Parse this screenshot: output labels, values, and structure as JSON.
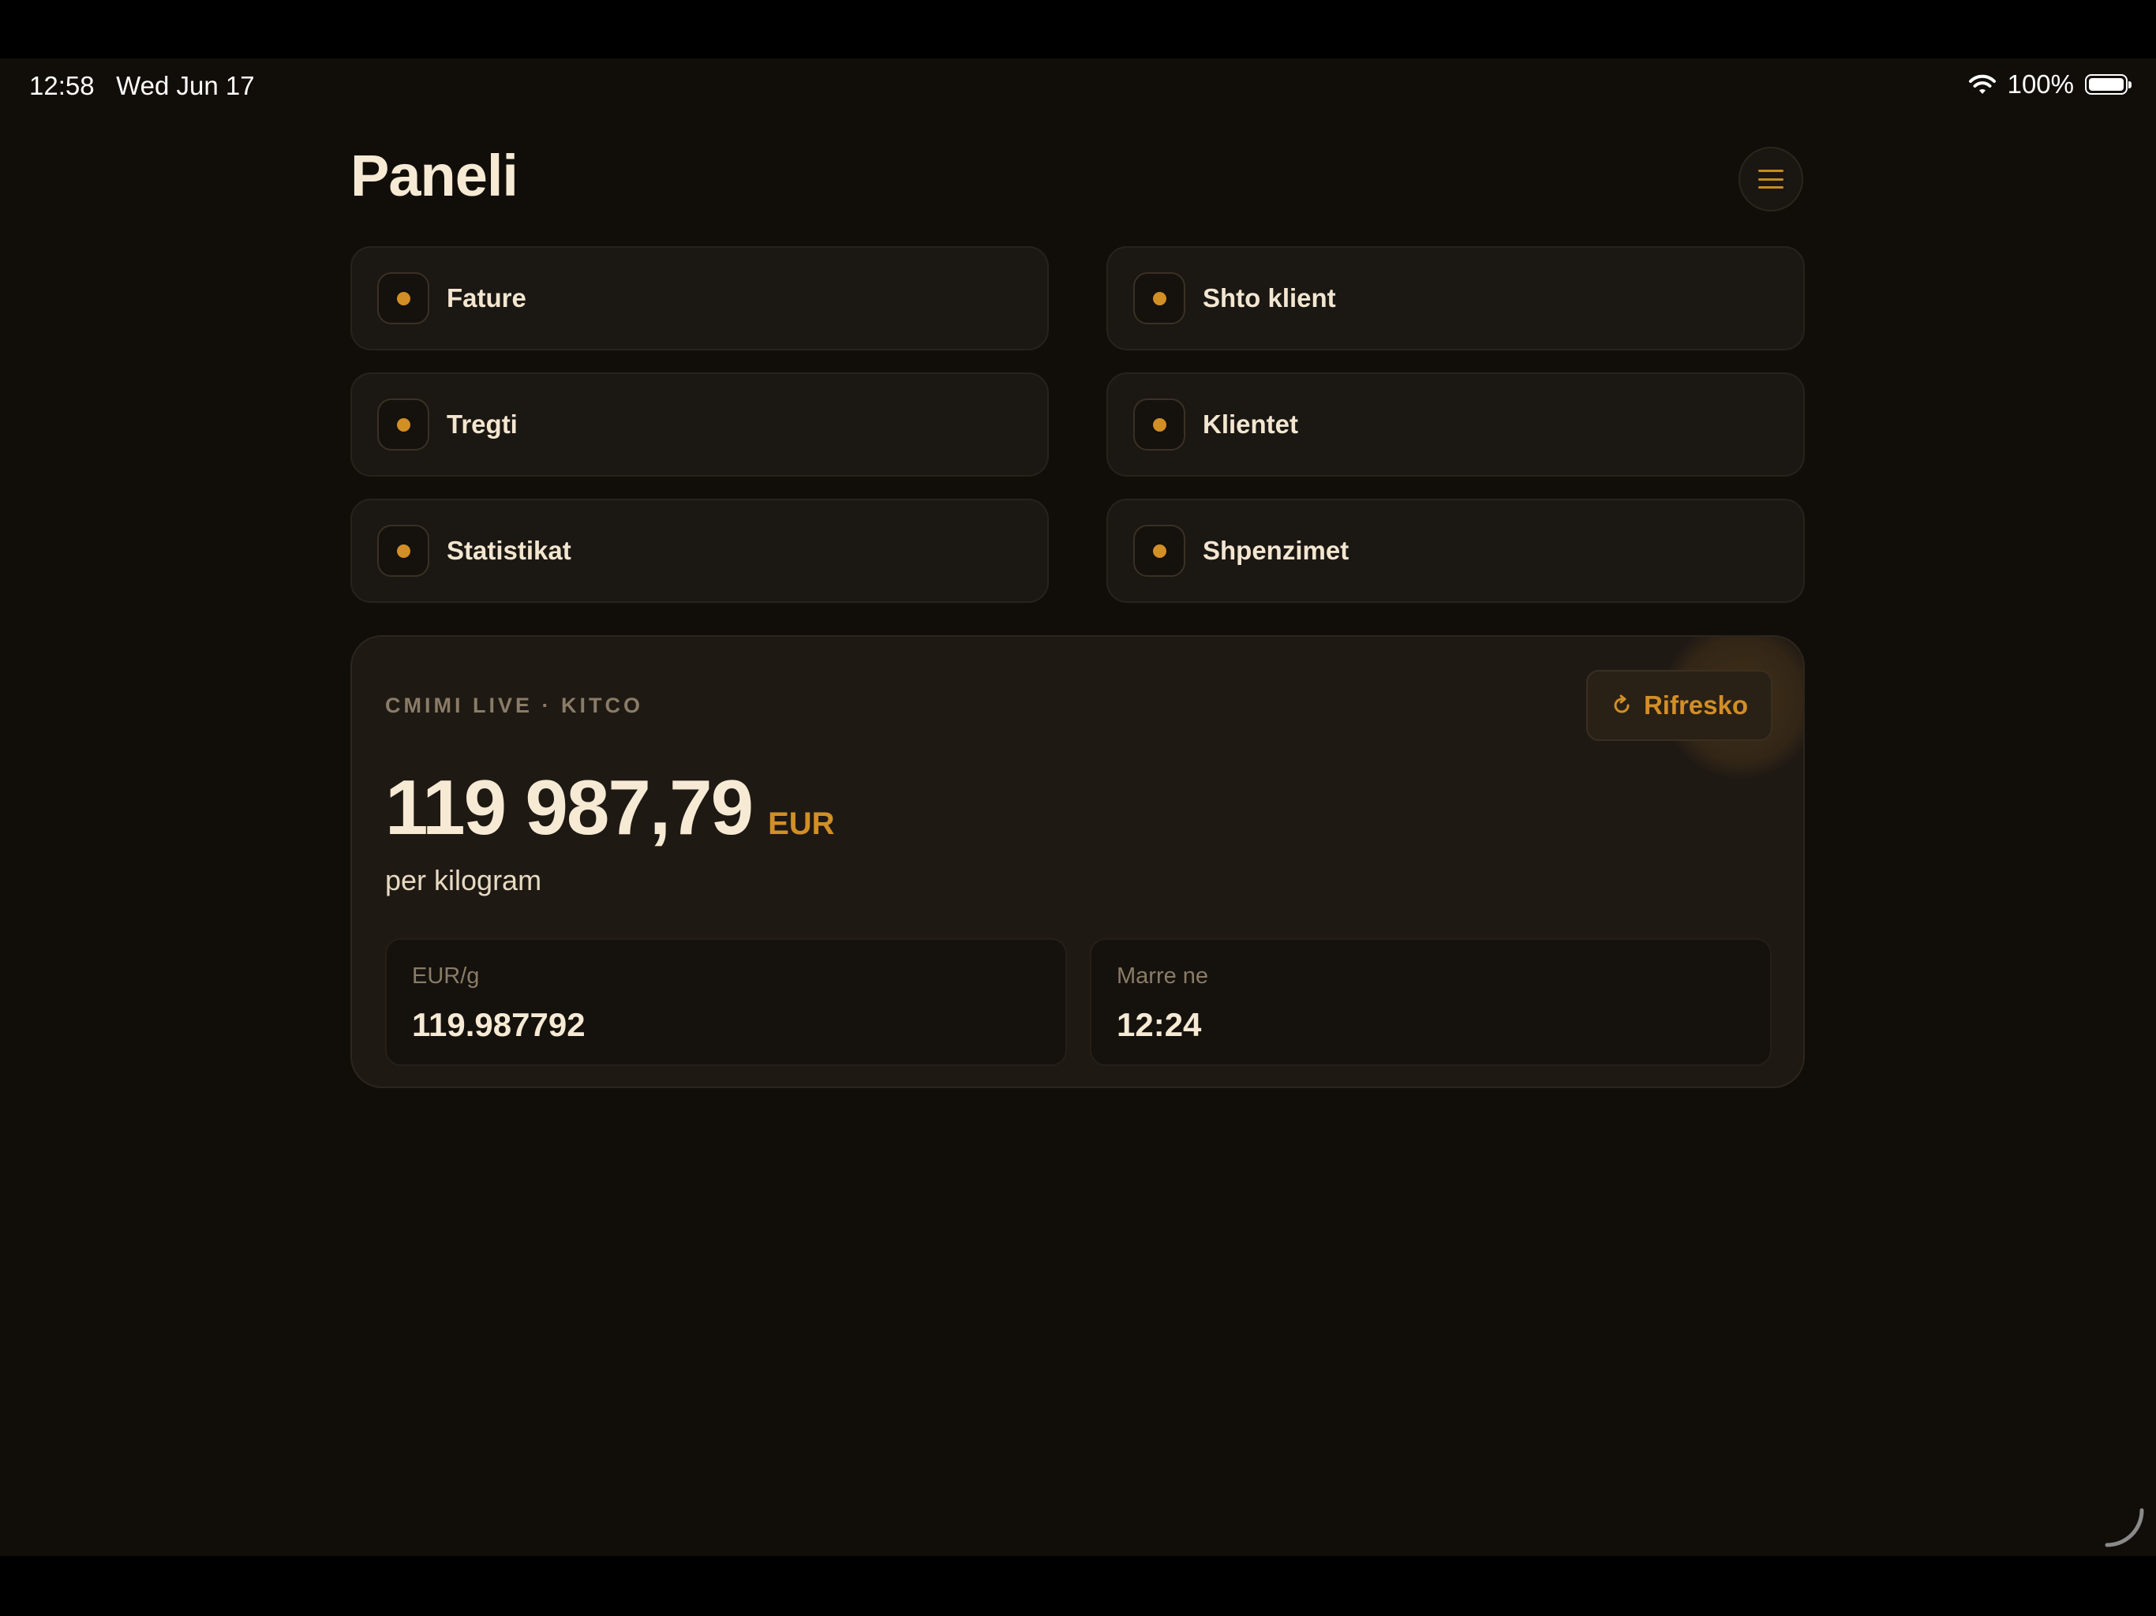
{
  "status_bar": {
    "time_date": "12:58   Wed Jun 17",
    "battery_percent": "100%",
    "battery_level": 1.0
  },
  "header": {
    "title": "Paneli",
    "menu_icon": "hamburger-menu-icon"
  },
  "nav": {
    "items": [
      {
        "label": "Fature"
      },
      {
        "label": "Shto klient"
      },
      {
        "label": "Tregti"
      },
      {
        "label": "Klientet"
      },
      {
        "label": "Statistikat"
      },
      {
        "label": "Shpenzimet"
      }
    ]
  },
  "price_card": {
    "source": "CMIMI LIVE · KITCO",
    "refresh_label": "Rifresko",
    "price": "119 987,79",
    "currency": "EUR",
    "unit": "per kilogram",
    "stats": [
      {
        "label": "EUR/g",
        "value": "119.987792"
      },
      {
        "label": "Marre ne",
        "value": "12:24"
      }
    ]
  },
  "colors": {
    "background": "#110e0a",
    "card": "#1b1713",
    "accent": "#d28f26",
    "text": "#f6ead4",
    "muted": "#8a7c66"
  }
}
